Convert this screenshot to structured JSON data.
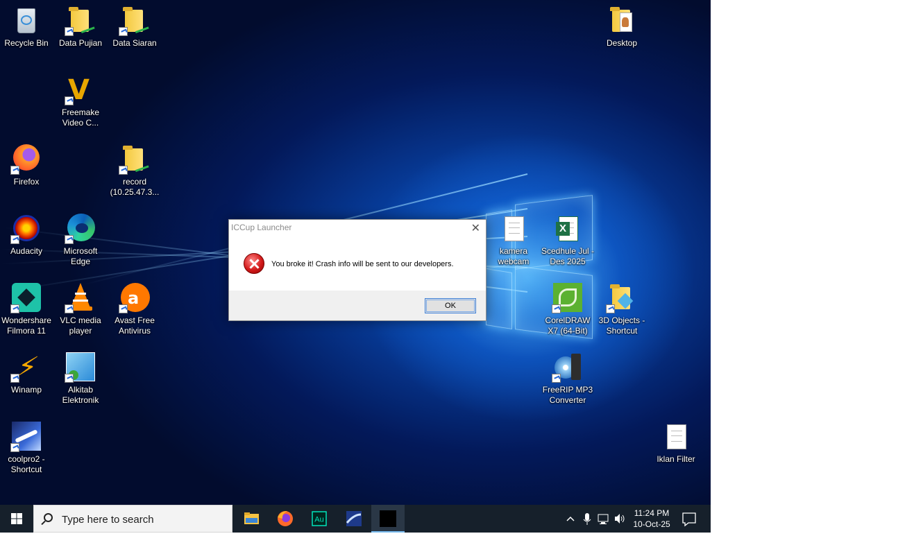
{
  "desktop": {
    "icons": [
      {
        "id": "recycle-bin",
        "label": "Recycle Bin"
      },
      {
        "id": "data-pujian",
        "label": "Data Pujian"
      },
      {
        "id": "data-siaran",
        "label": "Data Siaran"
      },
      {
        "id": "desktop",
        "label": "Desktop"
      },
      {
        "id": "freemake",
        "label": "Freemake Video C..."
      },
      {
        "id": "firefox",
        "label": "Firefox"
      },
      {
        "id": "record",
        "label": "record (10.25.47.3..."
      },
      {
        "id": "audacity",
        "label": "Audacity"
      },
      {
        "id": "edge",
        "label": "Microsoft Edge"
      },
      {
        "id": "kamera",
        "label": "kamera webcam"
      },
      {
        "id": "scedhule",
        "label": "Scedhule Jul - Des 2025"
      },
      {
        "id": "filmora",
        "label": "Wondershare Filmora 11"
      },
      {
        "id": "vlc",
        "label": "VLC media player"
      },
      {
        "id": "avast",
        "label": "Avast Free Antivirus"
      },
      {
        "id": "coreldraw",
        "label": "CorelDRAW X7 (64-Bit)"
      },
      {
        "id": "objects3d",
        "label": "3D Objects - Shortcut"
      },
      {
        "id": "winamp",
        "label": "Winamp"
      },
      {
        "id": "alkitab",
        "label": "Alkitab Elektronik"
      },
      {
        "id": "freerip",
        "label": "FreeRIP MP3 Converter"
      },
      {
        "id": "coolpro",
        "label": "coolpro2 - Shortcut"
      },
      {
        "id": "iklan",
        "label": "Iklan Filter"
      }
    ]
  },
  "dialog": {
    "title": "ICCup Launcher",
    "message": "You broke it! Crash info will be sent to our developers.",
    "ok_label": "OK",
    "close_glyph": "✕"
  },
  "taskbar": {
    "search_placeholder": "Type here to search",
    "apps": [
      "file-explorer",
      "firefox",
      "adobe-audition",
      "coolpro2",
      "terminal"
    ],
    "clock": {
      "time": "11:24 PM",
      "date": "10-Oct-25"
    },
    "accent": "#76b9ed"
  }
}
